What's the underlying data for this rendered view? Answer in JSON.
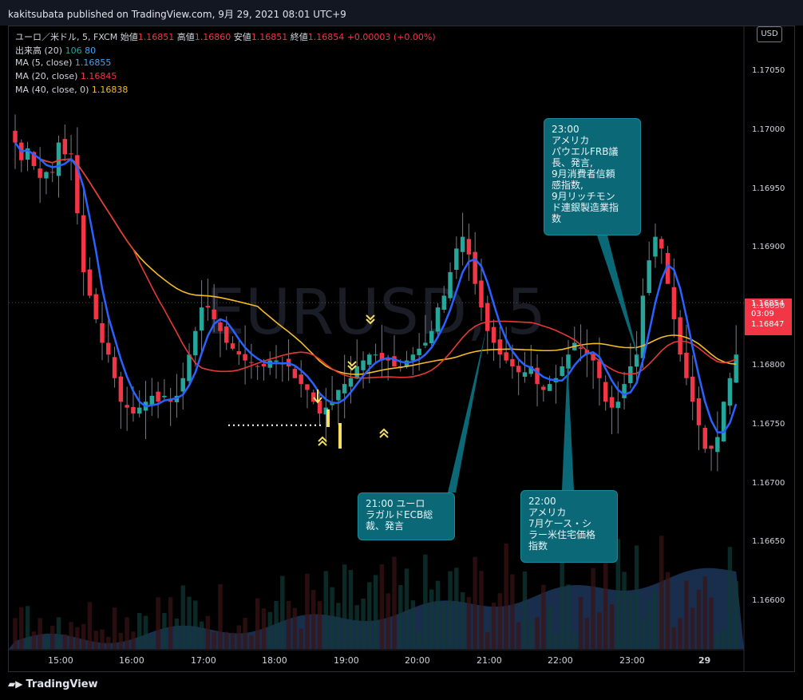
{
  "header": {
    "published": "kakitsubata published on TradingView.com, 9月 29, 2021 08:01 UTC+9"
  },
  "legend": {
    "symbol": "ユーロ／米ドル, 5, FXCM",
    "open_label": "始値",
    "open": "1.16851",
    "high_label": "高値",
    "high": "1.16860",
    "low_label": "安値",
    "low": "1.16851",
    "close_label": "終値",
    "close": "1.16854",
    "change": "+0.00003 (+0.00%)",
    "volume_label": "出来高 (20)",
    "volume_val1": "106",
    "volume_val2": "80",
    "ma5_label": "MA (5, close)",
    "ma5_val": "1.16855",
    "ma20_label": "MA (20, close)",
    "ma20_val": "1.16845",
    "ma40_label": "MA (40, close, 0)",
    "ma40_val": "1.16838"
  },
  "currency_button": "USD",
  "watermark": "EURUSD, 5",
  "price_tag": {
    "price": "1.16854",
    "countdown": "03:09",
    "ma_value": "1.16847"
  },
  "annotations": [
    {
      "id": "fed",
      "text": "23:00\nアメリカ\nパウエルFRB議\n長、発言,\n9月消費者信頼\n感指数,\n9月リッチモン\nド連銀製造業指\n数"
    },
    {
      "id": "ecb",
      "text": "21:00 ユーロ\nラガルドECB総\n裁、発言"
    },
    {
      "id": "case",
      "text": "22:00\nアメリカ\n7月ケース・シ\nラー米住宅価格\n指数"
    }
  ],
  "footer": {
    "logo": "TradingView"
  },
  "colors": {
    "up": "#26a69a",
    "down": "#f23645",
    "ma5": "#2962ff",
    "ma20": "#e53935",
    "ma40": "#f6bc23",
    "background": "#000000"
  },
  "chart_data": {
    "type": "candlestick",
    "symbol": "EURUSD",
    "timeframe": "5",
    "x_ticks": [
      "15:00",
      "16:00",
      "17:00",
      "18:00",
      "19:00",
      "20:00",
      "21:00",
      "22:00",
      "23:00",
      "29"
    ],
    "y_ticks": [
      1.166,
      1.1665,
      1.167,
      1.1675,
      1.168,
      1.1685,
      1.169,
      1.1695,
      1.17,
      1.1705
    ],
    "ylim": [
      1.16565,
      1.1708
    ],
    "current_price": 1.16854,
    "candles_close": [
      1.1699,
      1.16975,
      1.16985,
      1.1697,
      1.1696,
      1.16965,
      1.16965,
      1.1699,
      1.1698,
      1.1698,
      1.1693,
      1.1688,
      1.1686,
      1.1684,
      1.1682,
      1.1681,
      1.1679,
      1.1677,
      1.16765,
      1.1676,
      1.16765,
      1.1677,
      1.16775,
      1.1677,
      1.16775,
      1.1677,
      1.16775,
      1.1679,
      1.1681,
      1.1683,
      1.1685,
      1.1685,
      1.1684,
      1.1683,
      1.1682,
      1.16815,
      1.1681,
      1.16805,
      1.16803,
      1.168,
      1.168,
      1.16805,
      1.16805,
      1.16803,
      1.168,
      1.1679,
      1.16785,
      1.1678,
      1.1677,
      1.1676,
      1.16765,
      1.1677,
      1.1678,
      1.16785,
      1.1679,
      1.168,
      1.16805,
      1.1681,
      1.1681,
      1.16805,
      1.16805,
      1.168,
      1.168,
      1.16805,
      1.1681,
      1.16815,
      1.1682,
      1.1683,
      1.1685,
      1.1686,
      1.1688,
      1.169,
      1.1691,
      1.16895,
      1.1687,
      1.1685,
      1.1683,
      1.1682,
      1.1681,
      1.16805,
      1.168,
      1.16795,
      1.16795,
      1.168,
      1.16785,
      1.1678,
      1.16785,
      1.1679,
      1.168,
      1.1681,
      1.1682,
      1.16815,
      1.1681,
      1.16805,
      1.1679,
      1.1677,
      1.16765,
      1.1677,
      1.16785,
      1.168,
      1.1681,
      1.1686,
      1.1689,
      1.1691,
      1.169,
      1.1687,
      1.1684,
      1.1681,
      1.1679,
      1.1677,
      1.1675,
      1.1673,
      1.1673,
      1.1674,
      1.1677,
      1.1679,
      1.1681
    ],
    "ma5_last": 1.16855,
    "ma20_last": 1.16845,
    "ma40_last": 1.16838,
    "volume_last": [
      106,
      80
    ]
  }
}
